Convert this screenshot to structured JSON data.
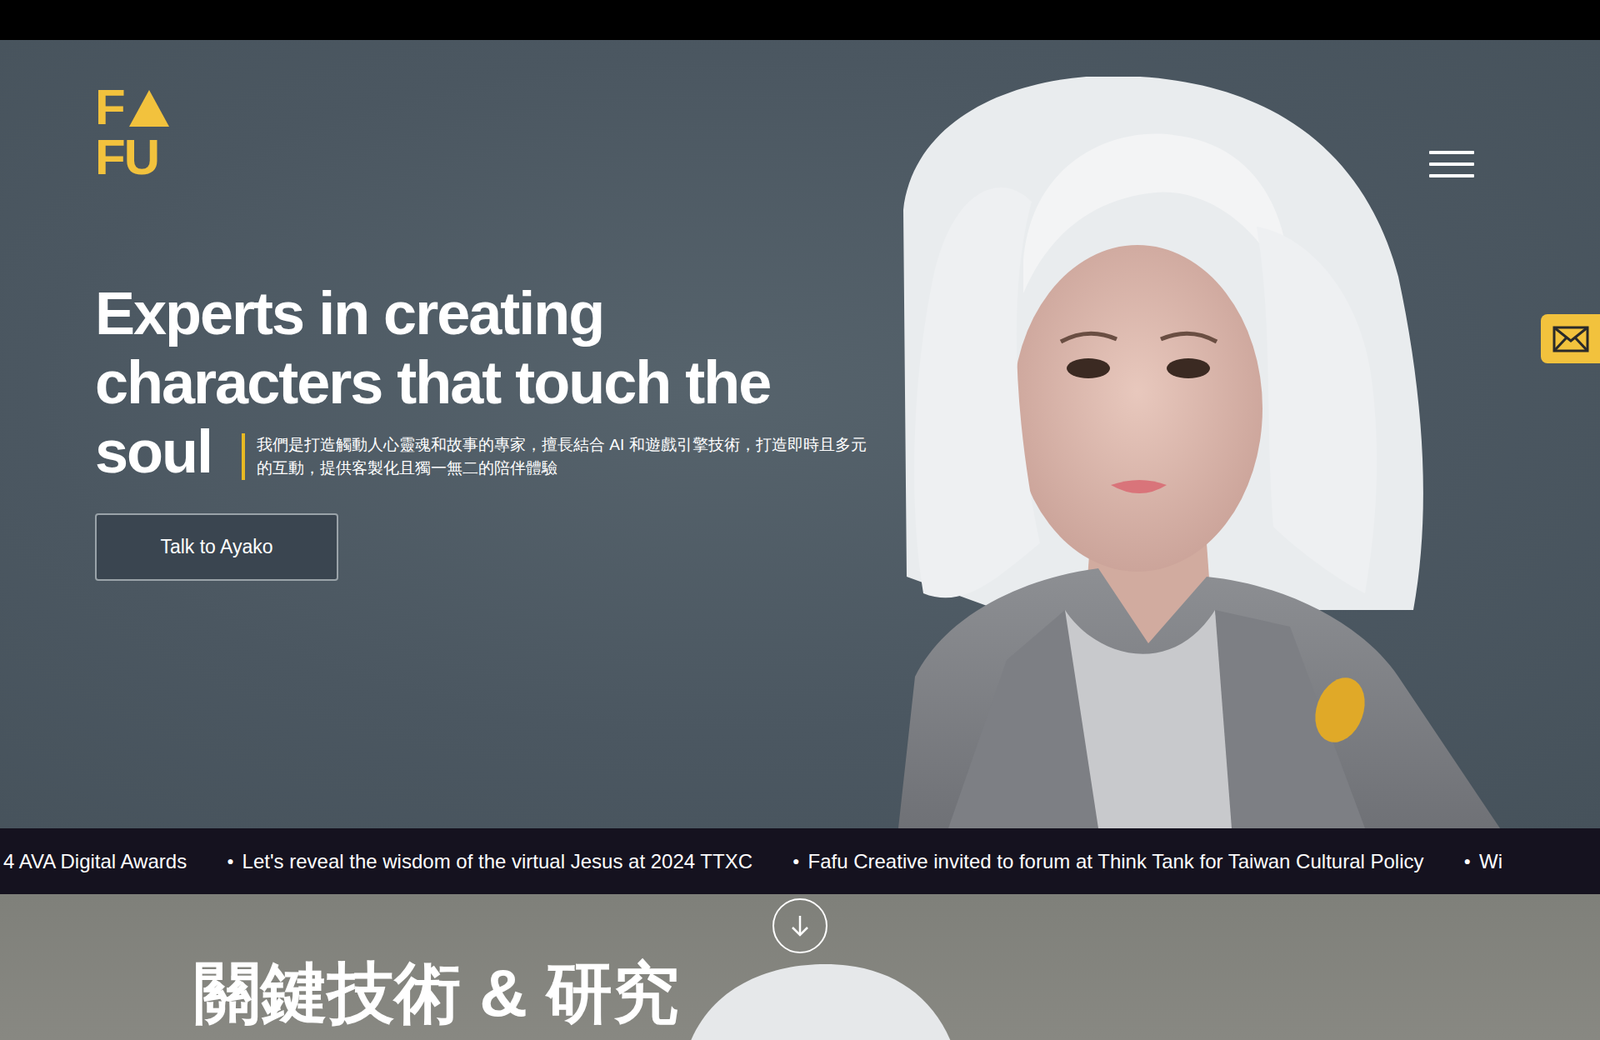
{
  "logo": {
    "top": "F",
    "bottom": "FU"
  },
  "hero": {
    "title_lines": [
      "Experts in creating",
      "characters that touch the",
      "soul"
    ],
    "description": "我們是打造觸動人心靈魂和故事的專家，擅長結合 AI 和遊戲引擎技術，打造即時且多元的互動，提供客製化且獨一無二的陪伴體驗",
    "button": "Talk to Ayako"
  },
  "ticker": [
    {
      "text": "4 AVA Digital Awards"
    },
    {
      "bullet": "●",
      "text": "Let's reveal the wisdom of the virtual Jesus at 2024 TTXC"
    },
    {
      "bullet": "●",
      "text": "Fafu Creative invited to forum at Think Tank for Taiwan Cultural Policy"
    },
    {
      "bullet": "●",
      "text": "Wi"
    }
  ],
  "section": {
    "title": "關鍵技術 & 研究"
  }
}
